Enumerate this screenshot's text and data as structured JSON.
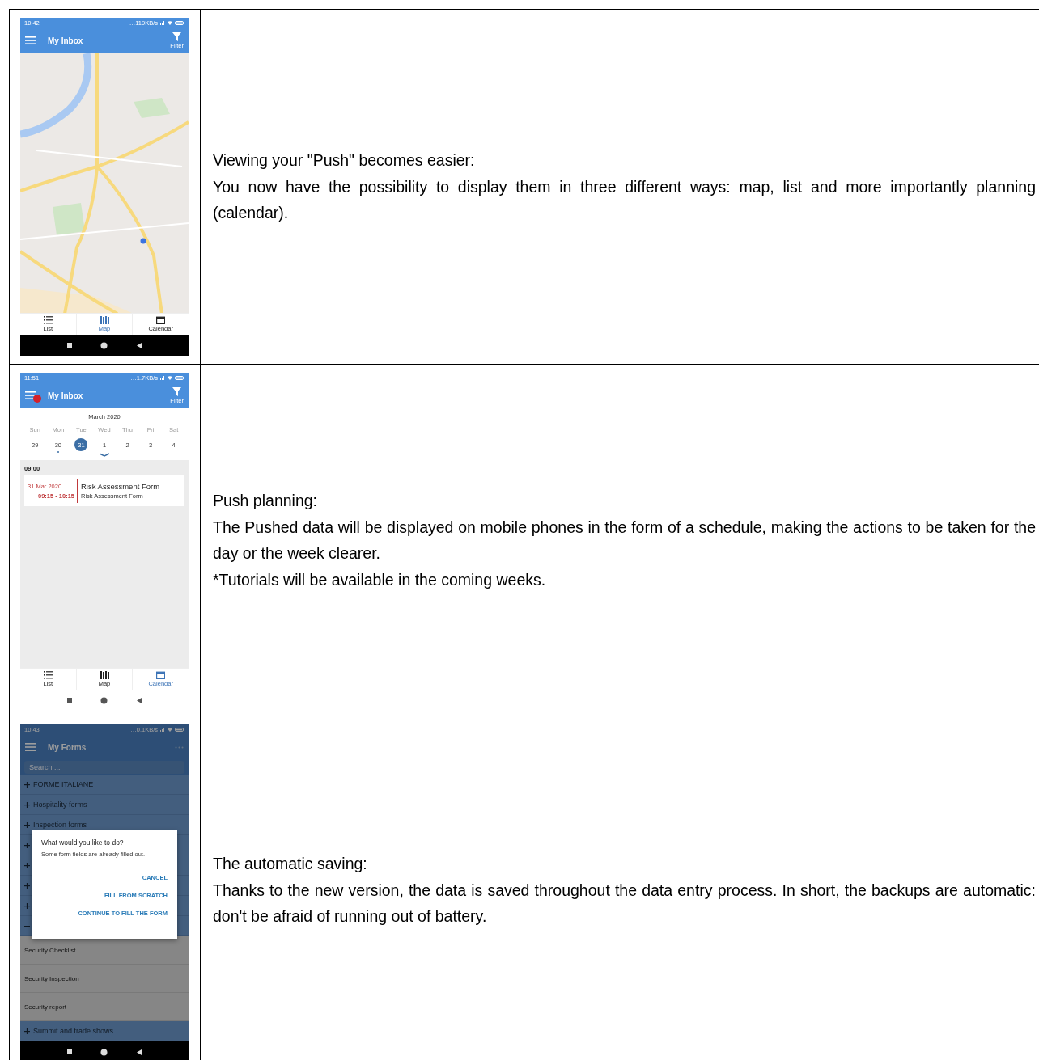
{
  "rows": [
    {
      "phone": {
        "kind": "map",
        "status": {
          "time": "10:42",
          "speed": "…119KB/s"
        },
        "header": {
          "title": "My Inbox",
          "action": "Filter"
        },
        "tabs": [
          {
            "label": "List",
            "selected": false
          },
          {
            "label": "Map",
            "selected": true
          },
          {
            "label": "Calendar",
            "selected": false
          }
        ],
        "dark_nav": true
      },
      "paragraphs": [
        "Viewing your \"Push\" becomes easier:",
        "You now have the possibility to display them in three different ways: map, list and more importantly planning (calendar)."
      ]
    },
    {
      "phone": {
        "kind": "calendar",
        "status": {
          "time": "11:51",
          "speed": "…1.7KB/s"
        },
        "header": {
          "title": "My Inbox",
          "badge": true,
          "action": "Filter"
        },
        "month": "March 2020",
        "weekdays": [
          "Sun",
          "Mon",
          "Tue",
          "Wed",
          "Thu",
          "Fri",
          "Sat"
        ],
        "dates": [
          {
            "label": "29",
            "selected": false,
            "marked": false
          },
          {
            "label": "30",
            "selected": false,
            "marked": true
          },
          {
            "label": "31",
            "selected": true,
            "marked": false
          },
          {
            "label": "1",
            "selected": false,
            "marked": false
          },
          {
            "label": "2",
            "selected": false,
            "marked": false
          },
          {
            "label": "3",
            "selected": false,
            "marked": false
          },
          {
            "label": "4",
            "selected": false,
            "marked": false
          }
        ],
        "time_header": "09:00",
        "events": [
          {
            "date": "31 Mar 2020",
            "time": "09:15 - 10:15",
            "title": "Risk Assessment Form",
            "subtitle": "Risk Assessment Form"
          }
        ],
        "tabs": [
          {
            "label": "List",
            "selected": false
          },
          {
            "label": "Map",
            "selected": false
          },
          {
            "label": "Calendar",
            "selected": true
          }
        ],
        "dark_nav": false
      },
      "paragraphs": [
        "Push planning:",
        "The Pushed data will be displayed on mobile phones in the form of a schedule, making the actions to be taken for the day or the week clearer.",
        "*Tutorials will be available in the coming weeks."
      ]
    },
    {
      "phone": {
        "kind": "forms",
        "status": {
          "time": "10:43",
          "speed": "…0.1KB/s"
        },
        "header": {
          "title": "My Forms"
        },
        "search": {
          "placeholder": "Search ..."
        },
        "items": [
          {
            "kind": "group",
            "label": "FORME ITALIANE",
            "expanded": false
          },
          {
            "kind": "group",
            "label": "Hospitality forms",
            "expanded": false
          },
          {
            "kind": "group",
            "label": "Inspection forms",
            "expanded": false
          },
          {
            "kind": "group",
            "expanded": false
          },
          {
            "kind": "group",
            "expanded": false
          },
          {
            "kind": "group",
            "expanded": false
          },
          {
            "kind": "group",
            "expanded": false
          },
          {
            "kind": "group",
            "expanded": true
          },
          {
            "kind": "form",
            "label": "Security Checklist"
          },
          {
            "kind": "form",
            "label": "Security Inspection"
          },
          {
            "kind": "form",
            "label": "Security report"
          },
          {
            "kind": "group",
            "label": "Summit and trade shows",
            "expanded": false
          }
        ],
        "dialog": {
          "title": "What would you like to do?",
          "message": "Some form fields are already filled out.",
          "actions": [
            "CANCEL",
            "FILL FROM SCRATCH",
            "CONTINUE TO FILL THE FORM"
          ]
        },
        "dark_nav": true
      },
      "paragraphs": [
        "The automatic saving:",
        "Thanks to the new version, the data is saved throughout the data entry process. In short, the backups are automatic: don't be afraid of running out of battery."
      ]
    }
  ]
}
